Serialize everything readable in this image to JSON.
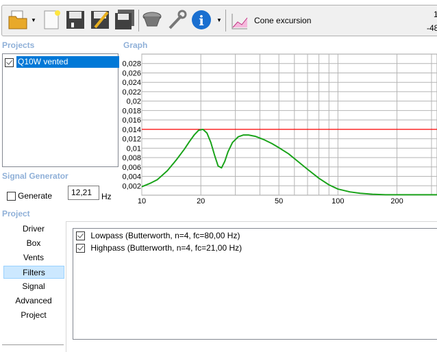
{
  "toolbar": {
    "items": [
      {
        "icon": "open-folder-icon",
        "dropdown": true
      },
      {
        "icon": "new-document-icon"
      },
      {
        "icon": "save-icon"
      },
      {
        "icon": "save-as-icon"
      },
      {
        "icon": "save-all-icon"
      },
      {
        "icon": "speaker-driver-icon"
      },
      {
        "icon": "wrench-icon"
      },
      {
        "icon": "info-icon",
        "dropdown": true
      }
    ],
    "graph_select": {
      "icon": "chart-icon",
      "label": "Cone excursion"
    },
    "readout_top": "1",
    "readout_bottom": "-48"
  },
  "projects": {
    "title": "Projects",
    "items": [
      {
        "label": "Q10W vented",
        "checked": true,
        "selected": true
      }
    ]
  },
  "graph": {
    "title": "Graph"
  },
  "signal_generator": {
    "title": "Signal Generator",
    "generate_label": "Generate",
    "generate_checked": false,
    "frequency": "12,21",
    "unit": "Hz"
  },
  "project": {
    "title": "Project",
    "nav": [
      "Driver",
      "Box",
      "Vents",
      "Filters",
      "Signal",
      "Advanced",
      "Project"
    ],
    "selected": "Filters",
    "filters": [
      {
        "label": "Lowpass (Butterworth, n=4, fc=80,00 Hz)",
        "checked": true
      },
      {
        "label": "Highpass (Butterworth, n=4, fc=21,00 Hz)",
        "checked": true
      }
    ]
  },
  "chart_data": {
    "type": "line",
    "xscale": "log",
    "xlim": [
      10,
      320
    ],
    "ylim": [
      0,
      0.03
    ],
    "xticks": [
      "10",
      "20",
      "50",
      "100",
      "200"
    ],
    "xtick_values": [
      10,
      20,
      50,
      100,
      200
    ],
    "yticks": [
      "0,002",
      "0,004",
      "0,006",
      "0,008",
      "0,01",
      "0,012",
      "0,014",
      "0,016",
      "0,018",
      "0,02",
      "0,022",
      "0,024",
      "0,026",
      "0,028"
    ],
    "ytick_values": [
      0.002,
      0.004,
      0.006,
      0.008,
      0.01,
      0.012,
      0.014,
      0.016,
      0.018,
      0.02,
      0.022,
      0.024,
      0.026,
      0.028
    ],
    "grid": true,
    "reference_line": {
      "y": 0.014,
      "color": "#ff0000"
    },
    "series": [
      {
        "color": "#1aa31a",
        "x": [
          10,
          11,
          12,
          13.5,
          15,
          16.5,
          17.5,
          18.5,
          19.5,
          20.5,
          21.5,
          22.5,
          23.5,
          24.5,
          25.5,
          26.5,
          27.5,
          29,
          31,
          33,
          35,
          38,
          42,
          46,
          50,
          56,
          62,
          70,
          80,
          90,
          100,
          115,
          130,
          150,
          175,
          200,
          250,
          320
        ],
        "y": [
          0.0018,
          0.0025,
          0.0033,
          0.0052,
          0.0075,
          0.0098,
          0.0114,
          0.0128,
          0.0138,
          0.014,
          0.0132,
          0.0112,
          0.0085,
          0.0062,
          0.0058,
          0.0072,
          0.0092,
          0.0112,
          0.0124,
          0.0128,
          0.0128,
          0.0125,
          0.0118,
          0.011,
          0.0101,
          0.0088,
          0.0073,
          0.0055,
          0.0036,
          0.0022,
          0.0013,
          0.0007,
          0.0004,
          0.0002,
          0.0001,
          0.0001,
          0.0001,
          0.0001
        ]
      }
    ]
  }
}
